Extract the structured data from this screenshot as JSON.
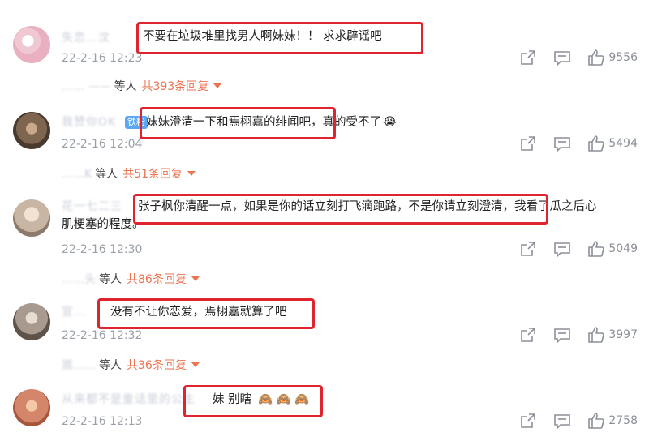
{
  "comments": [
    {
      "name": "失恋…汶",
      "text": "不要在垃圾堆里找男人啊妹妹！！ 求求辟谣吧",
      "time": "22-2-16 12:23",
      "likes": "9556",
      "replies_user": "…… ——",
      "replies_deng": "等人",
      "replies_count": "共393条回复",
      "avatar_color": "#f3dde3"
    },
    {
      "name": "我赞你OK",
      "badge": "铁粉",
      "text": "妹妹澄清一下和焉栩嘉的绯闻吧，真的受不了",
      "emoji": "😭",
      "time": "22-2-16 12:04",
      "likes": "5494",
      "replies_user": "……K",
      "replies_deng": "等人",
      "replies_count": "共51条回复",
      "avatar_color": "#8a7560"
    },
    {
      "name": "花一七二三",
      "text": "张子枫你清醒一点，如果是你的话立刻打飞滴跑路，不是你请立刻澄清，我看了瓜之后心",
      "text_line2": "肌梗塞的程度。",
      "time": "22-2-16 12:30",
      "likes": "5049",
      "replies_user": "……头",
      "replies_deng": "等人",
      "replies_count": "共86条回复",
      "avatar_color": "#c8b8a8"
    },
    {
      "name": "宣…",
      "text": "没有不让你恋爱，焉栩嘉就算了吧",
      "time": "22-2-16 12:32",
      "likes": "3997",
      "replies_user": "嵩……",
      "replies_deng": "等人",
      "replies_count": "共36条回复",
      "avatar_color": "#9b8f86"
    },
    {
      "name": "从来都不是童话里的公主",
      "text": "妹 别瞎",
      "emojis": "🙈 🙈 🙈",
      "time": "22-2-16 12:13",
      "likes": "2758",
      "avatar_color": "#d4866a"
    }
  ],
  "colors": {
    "highlight": "#e0242f",
    "reply_count": "#eb7350",
    "meta": "#9aa0a8"
  },
  "icons": [
    "share-icon",
    "comment-icon",
    "like-icon",
    "caret-down-icon"
  ]
}
